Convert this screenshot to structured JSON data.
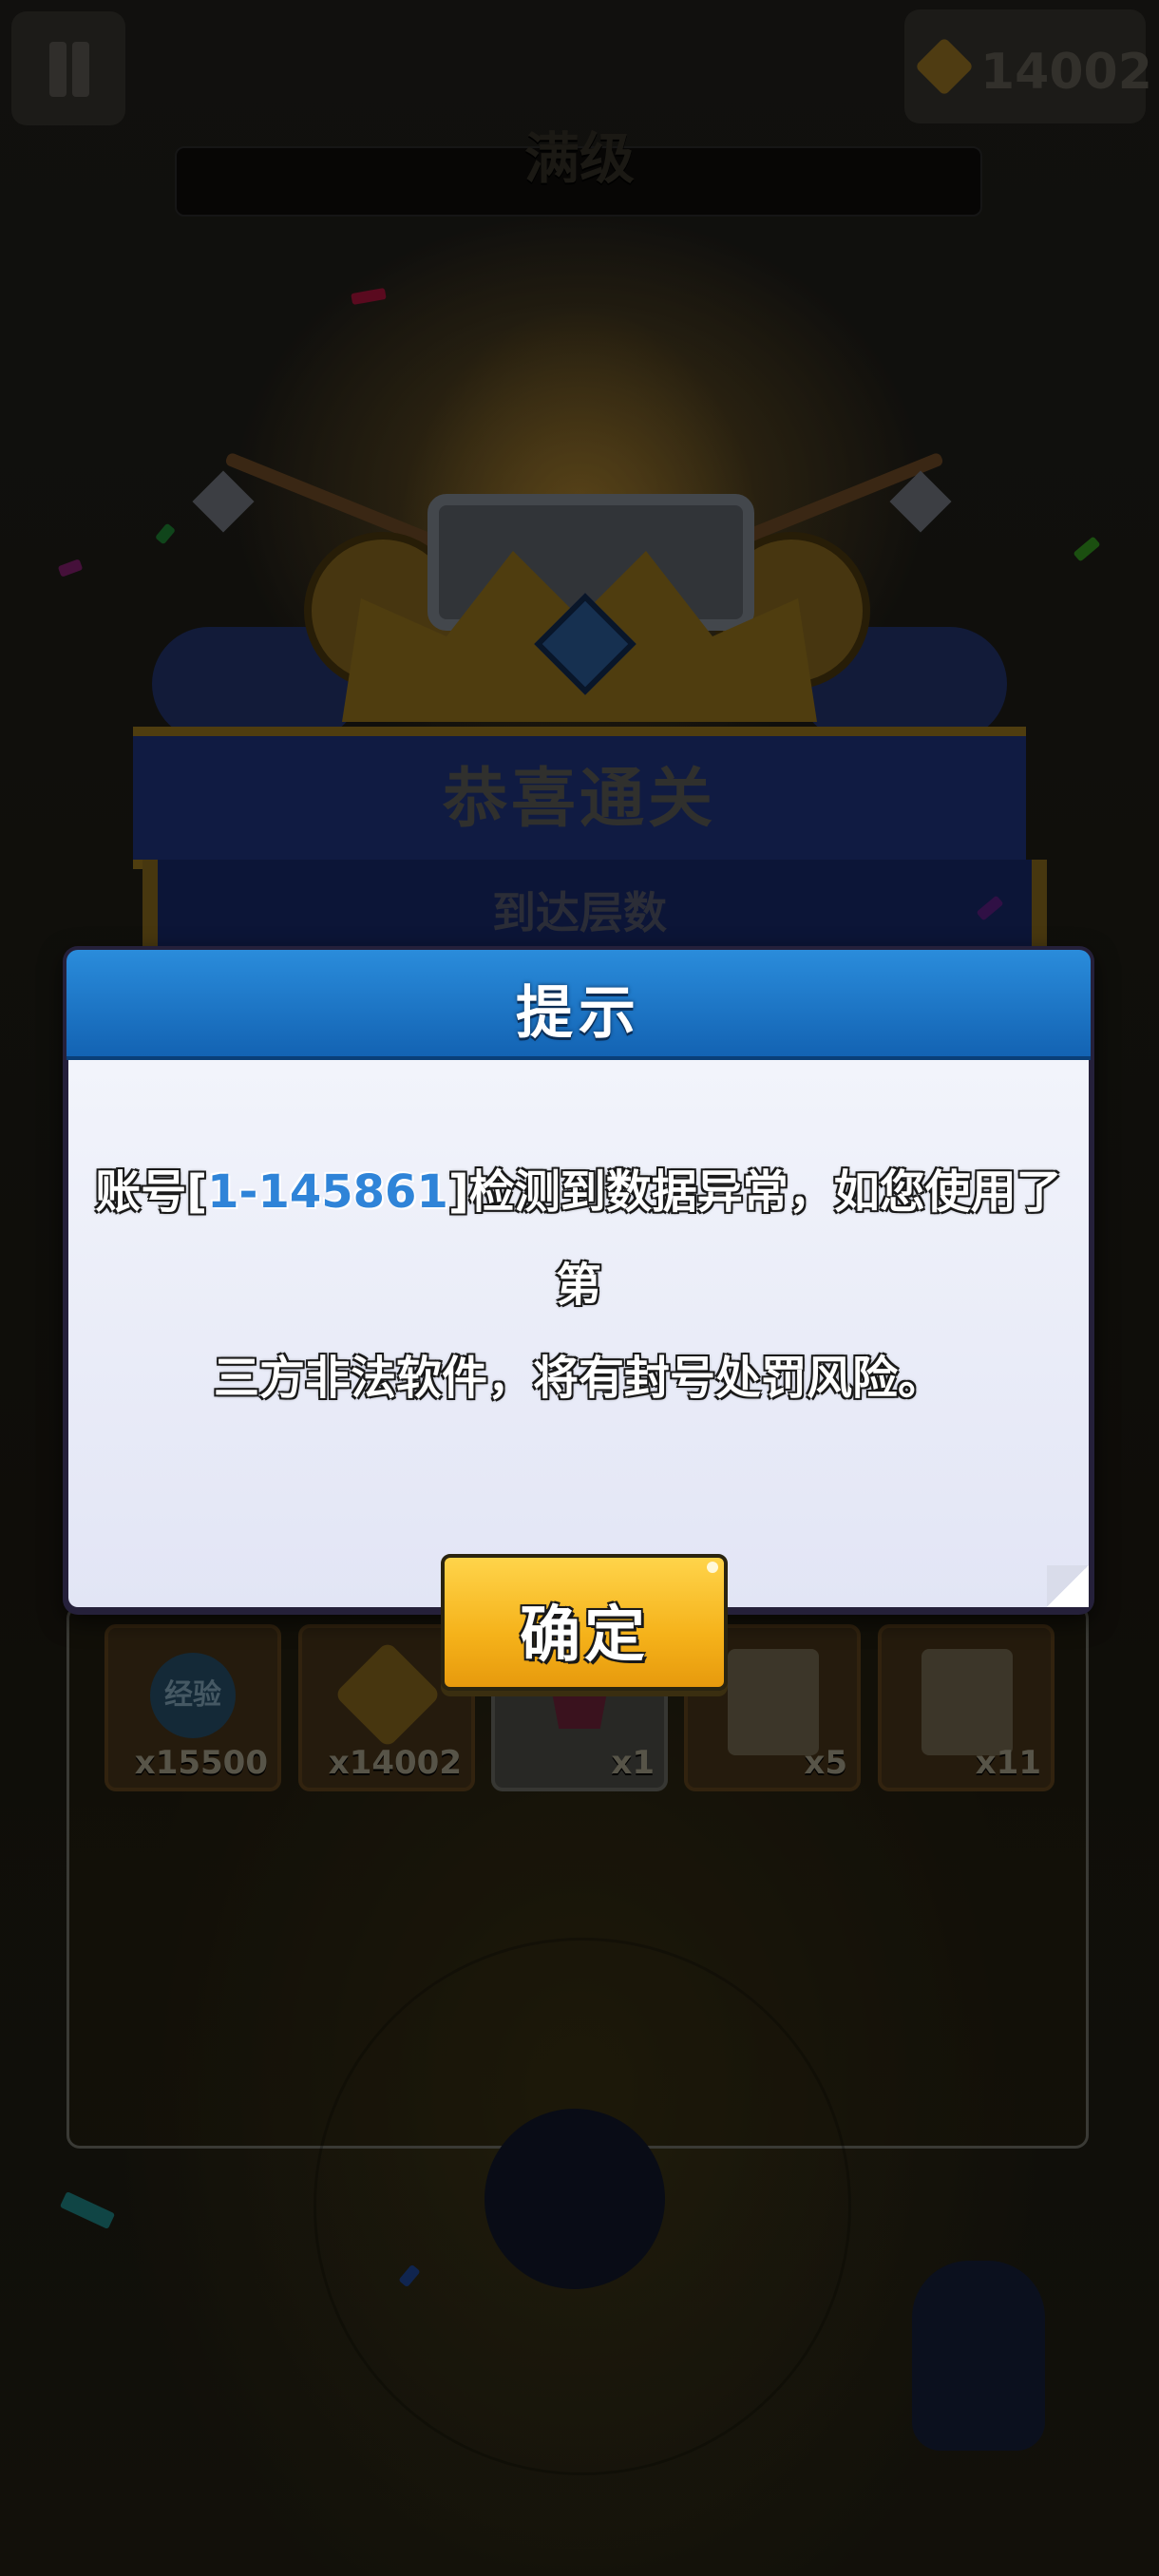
{
  "hud": {
    "currency_amount": "14002",
    "level_label": "满级"
  },
  "victory": {
    "title": "恭喜通关",
    "subtitle": "到达层数"
  },
  "rewards": [
    {
      "label": "经验",
      "qty": "x15500"
    },
    {
      "qty": "x14002"
    },
    {
      "badge": "1",
      "qty": "x1"
    },
    {
      "qty": "x5"
    },
    {
      "qty": "x11"
    }
  ],
  "dialog": {
    "title": "提示",
    "message_prefix": "账号[",
    "account_id": "1-145861",
    "message_line1_suffix": "]检测到数据异常，如您使用了第",
    "message_line2": "三方非法软件，将有封号处罚风险。",
    "confirm_label": "确定"
  },
  "colors": {
    "header_blue": "#1a78cc",
    "button_yellow": "#f7b81f",
    "account_id_blue": "#2f84d8"
  }
}
